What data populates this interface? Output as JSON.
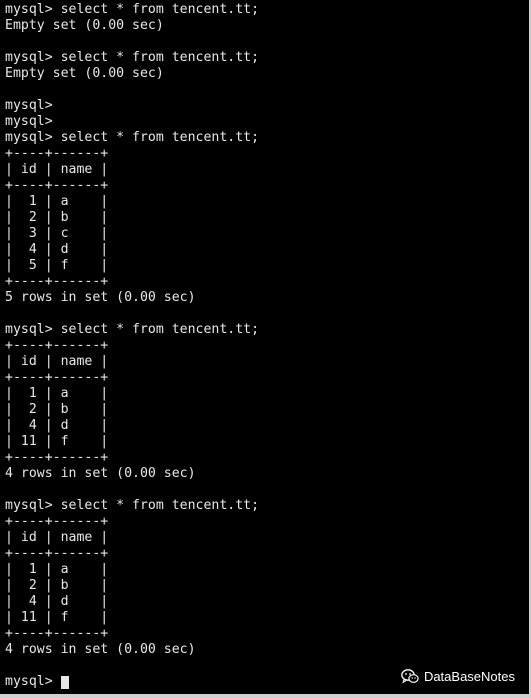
{
  "terminal": {
    "lines": [
      "mysql> select * from tencent.tt;",
      "Empty set (0.00 sec)",
      "",
      "mysql> select * from tencent.tt;",
      "Empty set (0.00 sec)",
      "",
      "mysql>",
      "mysql>",
      "mysql> select * from tencent.tt;",
      "+----+------+",
      "| id | name |",
      "+----+------+",
      "|  1 | a    |",
      "|  2 | b    |",
      "|  3 | c    |",
      "|  4 | d    |",
      "|  5 | f    |",
      "+----+------+",
      "5 rows in set (0.00 sec)",
      "",
      "mysql> select * from tencent.tt;",
      "+----+------+",
      "| id | name |",
      "+----+------+",
      "|  1 | a    |",
      "|  2 | b    |",
      "|  4 | d    |",
      "| 11 | f    |",
      "+----+------+",
      "4 rows in set (0.00 sec)",
      "",
      "mysql> select * from tencent.tt;",
      "+----+------+",
      "| id | name |",
      "+----+------+",
      "|  1 | a    |",
      "|  2 | b    |",
      "|  4 | d    |",
      "| 11 | f    |",
      "+----+------+",
      "4 rows in set (0.00 sec)",
      ""
    ],
    "prompt": "mysql> "
  },
  "watermark": {
    "text": "DataBaseNotes",
    "icon": "wechat-icon"
  },
  "colors": {
    "background": "#000000",
    "text": "#e8e8e8"
  }
}
